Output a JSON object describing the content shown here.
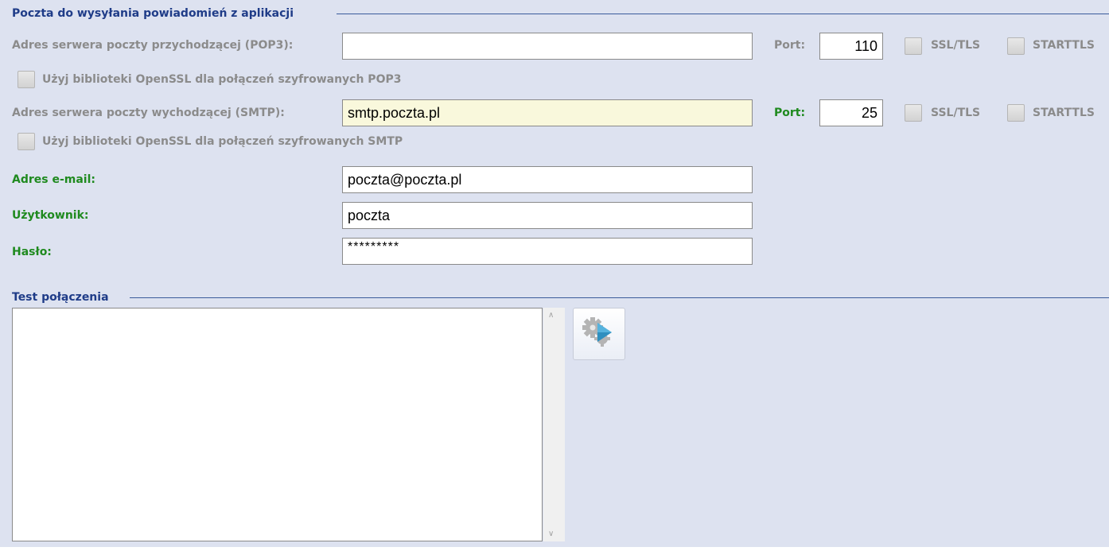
{
  "mail_group": {
    "title": "Poczta do wysyłania powiadomień z aplikacji",
    "pop3": {
      "label": "Adres serwera poczty przychodzącej (POP3):",
      "value": "",
      "port_label": "Port:",
      "port_value": "110",
      "ssl_label": "SSL/TLS",
      "starttls_label": "STARTTLS",
      "openssl_label": "Użyj biblioteki OpenSSL dla połączeń szyfrowanych POP3"
    },
    "smtp": {
      "label": "Adres serwera poczty wychodzącej (SMTP):",
      "value": "smtp.poczta.pl",
      "port_label": "Port:",
      "port_value": "25",
      "ssl_label": "SSL/TLS",
      "starttls_label": "STARTTLS",
      "openssl_label": "Użyj biblioteki OpenSSL dla połączeń szyfrowanych SMTP"
    },
    "email": {
      "label": "Adres e-mail:",
      "value": "poczta@poczta.pl"
    },
    "user": {
      "label": "Użytkownik:",
      "value": "poczta"
    },
    "password": {
      "label": "Hasło:",
      "value": "*********"
    }
  },
  "test_group": {
    "title": "Test połączenia",
    "log_text": "",
    "run_button_icon": "gear-play-icon"
  },
  "colors": {
    "background": "#dde2f0",
    "group_title": "#1f3c88",
    "required_label": "#1f8a1f",
    "disabled_label": "#8b8b8b",
    "smtp_field": "#f9f8dc"
  }
}
